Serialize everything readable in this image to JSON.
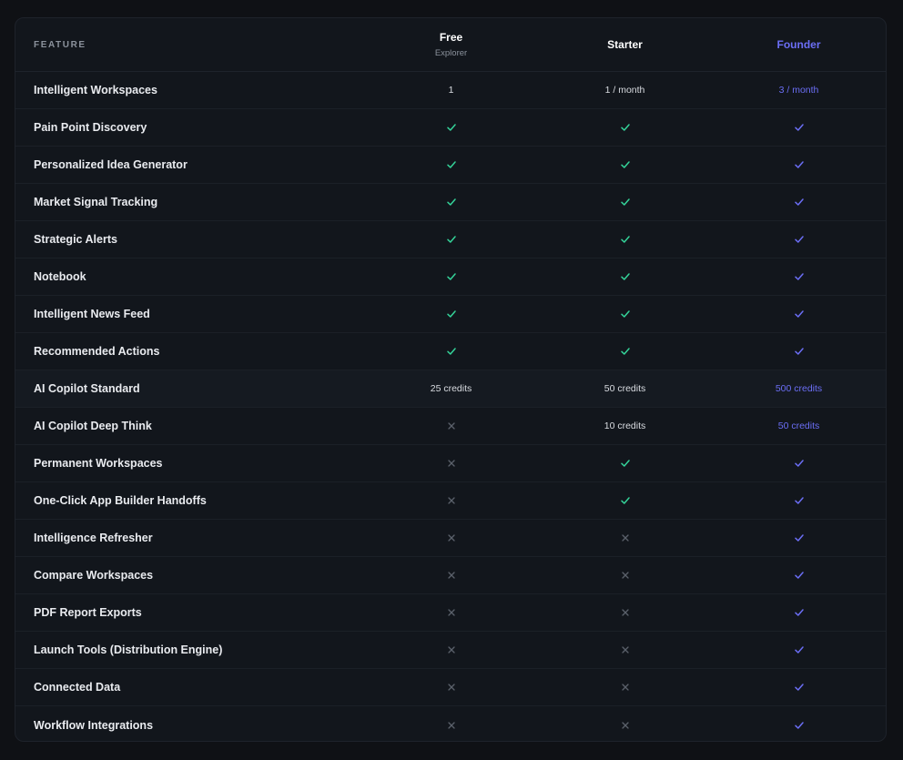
{
  "colors": {
    "background": "#0f1115",
    "card": "#12161c",
    "check_green": "#34d399",
    "check_founder": "#6b6ef5",
    "cross": "#5b616b",
    "founder_accent": "#6b6ef5"
  },
  "header": {
    "feature_label": "FEATURE",
    "plans": [
      {
        "name": "Free",
        "subtitle": "Explorer"
      },
      {
        "name": "Starter",
        "subtitle": ""
      },
      {
        "name": "Founder",
        "subtitle": ""
      }
    ]
  },
  "rows": [
    {
      "feature": "Intelligent Workspaces",
      "free": {
        "type": "text",
        "text": "1"
      },
      "starter": {
        "type": "text",
        "text": "1 / month"
      },
      "founder": {
        "type": "text",
        "text": "3 / month"
      }
    },
    {
      "feature": "Pain Point Discovery",
      "free": {
        "type": "check"
      },
      "starter": {
        "type": "check"
      },
      "founder": {
        "type": "check"
      }
    },
    {
      "feature": "Personalized Idea Generator",
      "free": {
        "type": "check"
      },
      "starter": {
        "type": "check"
      },
      "founder": {
        "type": "check"
      }
    },
    {
      "feature": "Market Signal Tracking",
      "free": {
        "type": "check"
      },
      "starter": {
        "type": "check"
      },
      "founder": {
        "type": "check"
      }
    },
    {
      "feature": "Strategic Alerts",
      "free": {
        "type": "check"
      },
      "starter": {
        "type": "check"
      },
      "founder": {
        "type": "check"
      }
    },
    {
      "feature": "Notebook",
      "free": {
        "type": "check"
      },
      "starter": {
        "type": "check"
      },
      "founder": {
        "type": "check"
      }
    },
    {
      "feature": "Intelligent News Feed",
      "free": {
        "type": "check"
      },
      "starter": {
        "type": "check"
      },
      "founder": {
        "type": "check"
      }
    },
    {
      "feature": "Recommended Actions",
      "free": {
        "type": "check"
      },
      "starter": {
        "type": "check"
      },
      "founder": {
        "type": "check"
      }
    },
    {
      "feature": "AI Copilot Standard",
      "free": {
        "type": "text",
        "text": "25 credits"
      },
      "starter": {
        "type": "text",
        "text": "50 credits"
      },
      "founder": {
        "type": "text",
        "text": "500 credits"
      },
      "highlight": true
    },
    {
      "feature": "AI Copilot Deep Think",
      "free": {
        "type": "cross"
      },
      "starter": {
        "type": "text",
        "text": "10 credits"
      },
      "founder": {
        "type": "text",
        "text": "50 credits"
      }
    },
    {
      "feature": "Permanent Workspaces",
      "free": {
        "type": "cross"
      },
      "starter": {
        "type": "check"
      },
      "founder": {
        "type": "check"
      }
    },
    {
      "feature": "One-Click App Builder Handoffs",
      "free": {
        "type": "cross"
      },
      "starter": {
        "type": "check"
      },
      "founder": {
        "type": "check"
      }
    },
    {
      "feature": "Intelligence Refresher",
      "free": {
        "type": "cross"
      },
      "starter": {
        "type": "cross"
      },
      "founder": {
        "type": "check"
      }
    },
    {
      "feature": "Compare Workspaces",
      "free": {
        "type": "cross"
      },
      "starter": {
        "type": "cross"
      },
      "founder": {
        "type": "check"
      }
    },
    {
      "feature": "PDF Report Exports",
      "free": {
        "type": "cross"
      },
      "starter": {
        "type": "cross"
      },
      "founder": {
        "type": "check"
      }
    },
    {
      "feature": "Launch Tools (Distribution Engine)",
      "free": {
        "type": "cross"
      },
      "starter": {
        "type": "cross"
      },
      "founder": {
        "type": "check"
      }
    },
    {
      "feature": "Connected Data",
      "free": {
        "type": "cross"
      },
      "starter": {
        "type": "cross"
      },
      "founder": {
        "type": "check"
      }
    },
    {
      "feature": "Workflow Integrations",
      "free": {
        "type": "cross"
      },
      "starter": {
        "type": "cross"
      },
      "founder": {
        "type": "check"
      }
    }
  ]
}
